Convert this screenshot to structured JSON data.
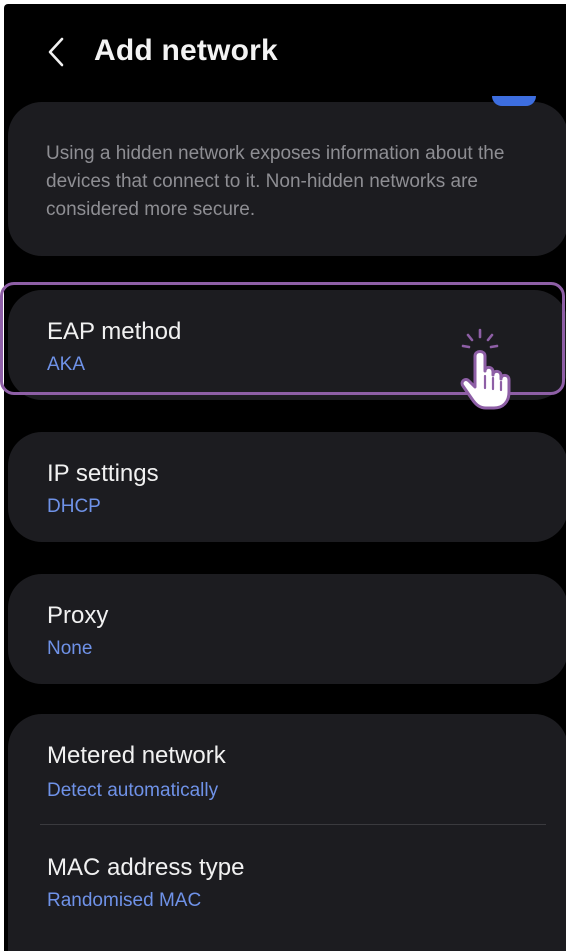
{
  "header": {
    "back_icon": "chevron-left-icon",
    "title": "Add network"
  },
  "hidden_network": {
    "toggle_on": true,
    "toggle_color": "#3d6ee0",
    "info_text": "Using a hidden network exposes information about the devices that connect to it. Non-hidden networks are considered more secure."
  },
  "settings": {
    "eap": {
      "label": "EAP method",
      "value": "AKA"
    },
    "ip": {
      "label": "IP settings",
      "value": "DHCP"
    },
    "proxy": {
      "label": "Proxy",
      "value": "None"
    },
    "metered": {
      "label": "Metered network",
      "value": "Detect automatically"
    },
    "mac": {
      "label": "MAC address type",
      "value": "Randomised MAC"
    }
  },
  "overlay": {
    "highlight_color": "#8e5fa6",
    "pointer_icon": "tap-hand-icon"
  },
  "colors": {
    "background": "#000000",
    "card": "#1c1c20",
    "value_text": "#6f92e8",
    "primary_text": "#f1f1f1",
    "secondary_text": "#8e8e93"
  }
}
